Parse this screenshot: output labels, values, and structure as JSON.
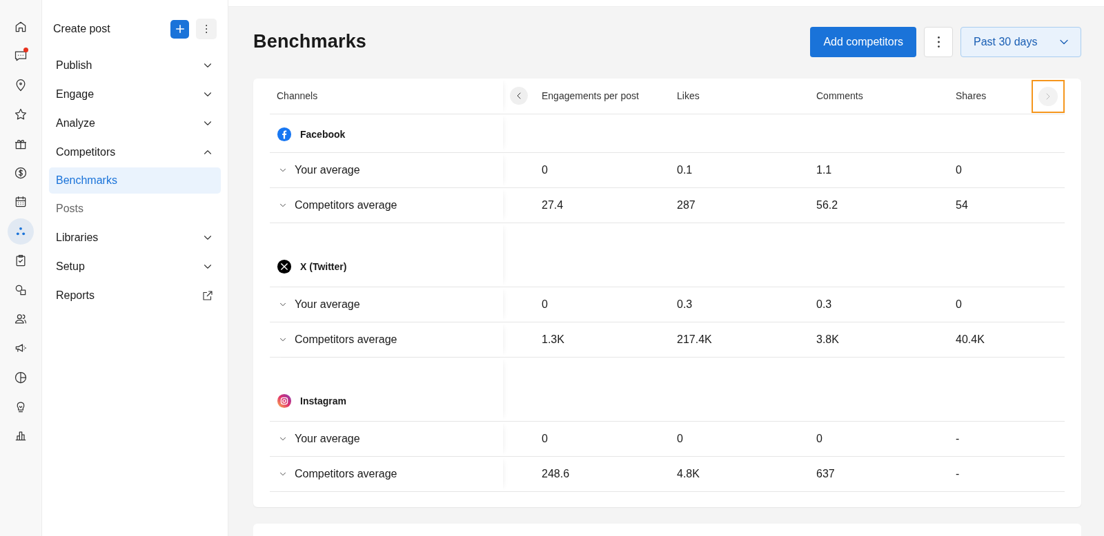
{
  "rail": [
    {
      "kind": "home",
      "selected": false,
      "badge": false
    },
    {
      "kind": "chat",
      "selected": false,
      "badge": true
    },
    {
      "kind": "pin",
      "selected": false,
      "badge": false
    },
    {
      "kind": "star",
      "selected": false,
      "badge": false
    },
    {
      "kind": "gift",
      "selected": false,
      "badge": false
    },
    {
      "kind": "dollar",
      "selected": false,
      "badge": false
    },
    {
      "kind": "calendar",
      "selected": false,
      "badge": false
    },
    {
      "kind": "dots",
      "selected": true,
      "badge": false
    },
    {
      "kind": "clipboard",
      "selected": false,
      "badge": false
    },
    {
      "kind": "shapes",
      "selected": false,
      "badge": false
    },
    {
      "kind": "people",
      "selected": false,
      "badge": false
    },
    {
      "kind": "megaphone",
      "selected": false,
      "badge": false
    },
    {
      "kind": "pie",
      "selected": false,
      "badge": false
    },
    {
      "kind": "bulb",
      "selected": false,
      "badge": false
    },
    {
      "kind": "bars",
      "selected": false,
      "badge": false
    }
  ],
  "nav": {
    "create_label": "Create post",
    "items": [
      {
        "kind": "group",
        "label": "Publish",
        "expanded": false
      },
      {
        "kind": "group",
        "label": "Engage",
        "expanded": false
      },
      {
        "kind": "group",
        "label": "Analyze",
        "expanded": false
      },
      {
        "kind": "group",
        "label": "Competitors",
        "expanded": true,
        "children": [
          {
            "label": "Benchmarks",
            "selected": true
          },
          {
            "label": "Posts",
            "selected": false
          }
        ]
      },
      {
        "kind": "group",
        "label": "Libraries",
        "expanded": false
      },
      {
        "kind": "group",
        "label": "Setup",
        "expanded": false
      },
      {
        "kind": "link",
        "label": "Reports"
      }
    ]
  },
  "page": {
    "title": "Benchmarks",
    "add_button": "Add competitors",
    "range": "Past 30 days"
  },
  "table": {
    "columns": [
      "Channels",
      "Engagements per post",
      "Likes",
      "Comments",
      "Shares"
    ],
    "channels": [
      {
        "kind": "facebook",
        "name": "Facebook",
        "rows": [
          {
            "label": "Your average",
            "values": [
              "0",
              "0.1",
              "1.1",
              "0"
            ]
          },
          {
            "label": "Competitors average",
            "values": [
              "27.4",
              "287",
              "56.2",
              "54"
            ]
          }
        ]
      },
      {
        "kind": "x",
        "name": "X (Twitter)",
        "rows": [
          {
            "label": "Your average",
            "values": [
              "0",
              "0.3",
              "0.3",
              "0"
            ]
          },
          {
            "label": "Competitors average",
            "values": [
              "1.3K",
              "217.4K",
              "3.8K",
              "40.4K"
            ]
          }
        ]
      },
      {
        "kind": "instagram",
        "name": "Instagram",
        "rows": [
          {
            "label": "Your average",
            "values": [
              "0",
              "0",
              "0",
              "-"
            ]
          },
          {
            "label": "Competitors average",
            "values": [
              "248.6",
              "4.8K",
              "637",
              "-"
            ]
          }
        ]
      }
    ]
  }
}
